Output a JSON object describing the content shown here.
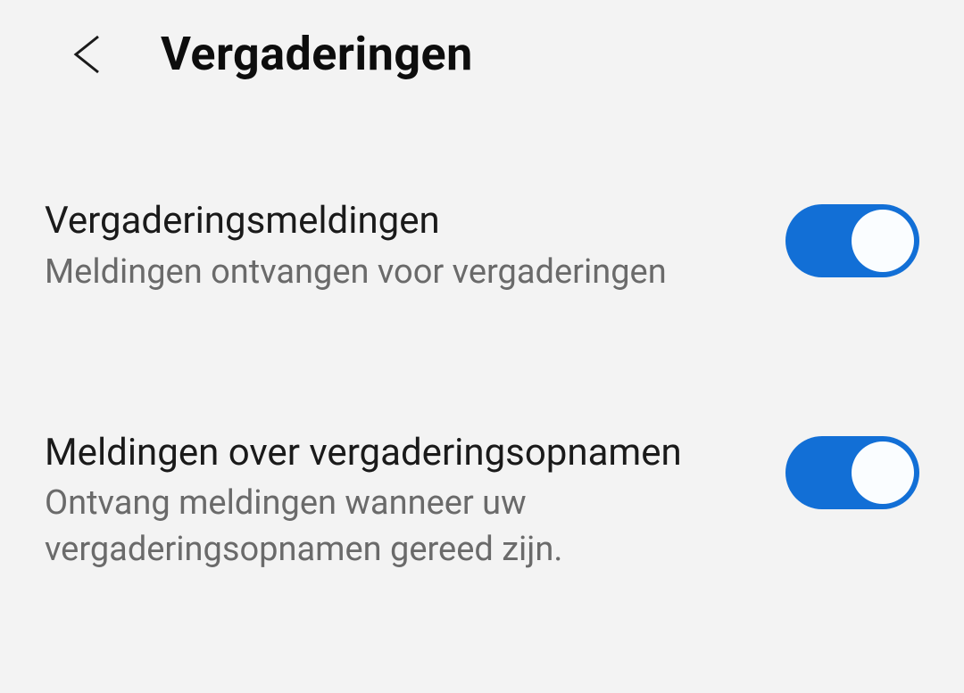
{
  "header": {
    "title": "Vergaderingen"
  },
  "settings": [
    {
      "title": "Vergaderingsmeldingen",
      "description": "Meldingen ontvangen voor vergaderingen",
      "enabled": true
    },
    {
      "title": "Meldingen over vergaderingsopnamen",
      "description": "Ontvang meldingen wanneer uw vergaderingsopnamen gereed zijn.",
      "enabled": true
    }
  ]
}
